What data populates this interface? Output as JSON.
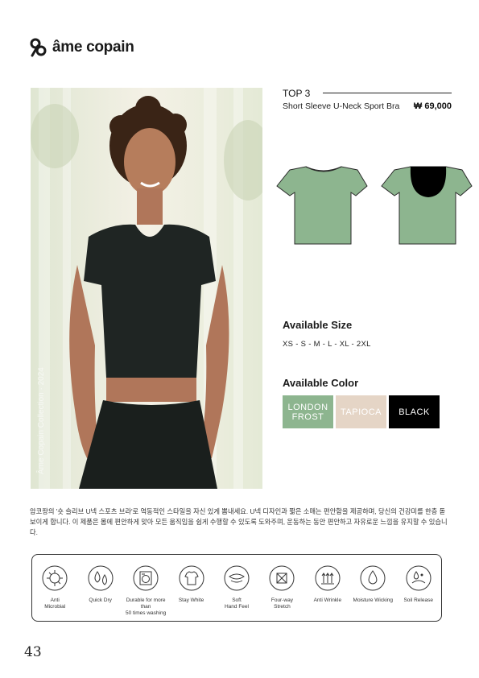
{
  "brand": {
    "name": "âme copain"
  },
  "product": {
    "rank": "TOP 3",
    "name": "Short Sleeve U-Neck Sport Bra",
    "price": "₩ 69,000",
    "photo_watermark": "Âme Copain Collection · 2024"
  },
  "sizes": {
    "title": "Available Size",
    "values": "XS - S - M - L - XL - 2XL"
  },
  "colors": {
    "title": "Available Color",
    "swatches": [
      {
        "label": "LONDON FROST",
        "hex": "#8db58f"
      },
      {
        "label": "TAPIOCA",
        "hex": "#e5d5c6"
      },
      {
        "label": "BLACK",
        "hex": "#000000"
      }
    ]
  },
  "description": "암코팡의 '숏 슬리브 U넥 스포츠 브라'로 역동적인 스타일을 자신 있게 뽐내세요. U넥 디자인과 짧은 소매는 편안함을 제공하며, 당신의 건강미를 한층 돋보이게 합니다. 이 제품은 몸에 편안하게 맞아 모든 움직임을 쉽게 수행할 수 있도록 도와주며, 운동하는 동안 편안하고 자유로운 느낌을 유지할 수 있습니다.",
  "features": [
    {
      "label": "Anti\nMicrobial",
      "icon": "anti-microbial-icon"
    },
    {
      "label": "Quick Dry",
      "icon": "quick-dry-icon"
    },
    {
      "label": "Durable for more than\n50 times washing",
      "icon": "washing-machine-icon"
    },
    {
      "label": "Stay White",
      "icon": "stay-white-icon"
    },
    {
      "label": "Soft\nHand Feel",
      "icon": "soft-hand-feel-icon"
    },
    {
      "label": "Four-way\nStretch",
      "icon": "four-way-stretch-icon"
    },
    {
      "label": "Anti Wrinkle",
      "icon": "anti-wrinkle-icon"
    },
    {
      "label": "Moisture Wicking",
      "icon": "moisture-wicking-icon"
    },
    {
      "label": "Soil Release",
      "icon": "soil-release-icon"
    }
  ],
  "page_number": "43",
  "theme": {
    "accent": "#8db58f",
    "ink": "#222222"
  }
}
